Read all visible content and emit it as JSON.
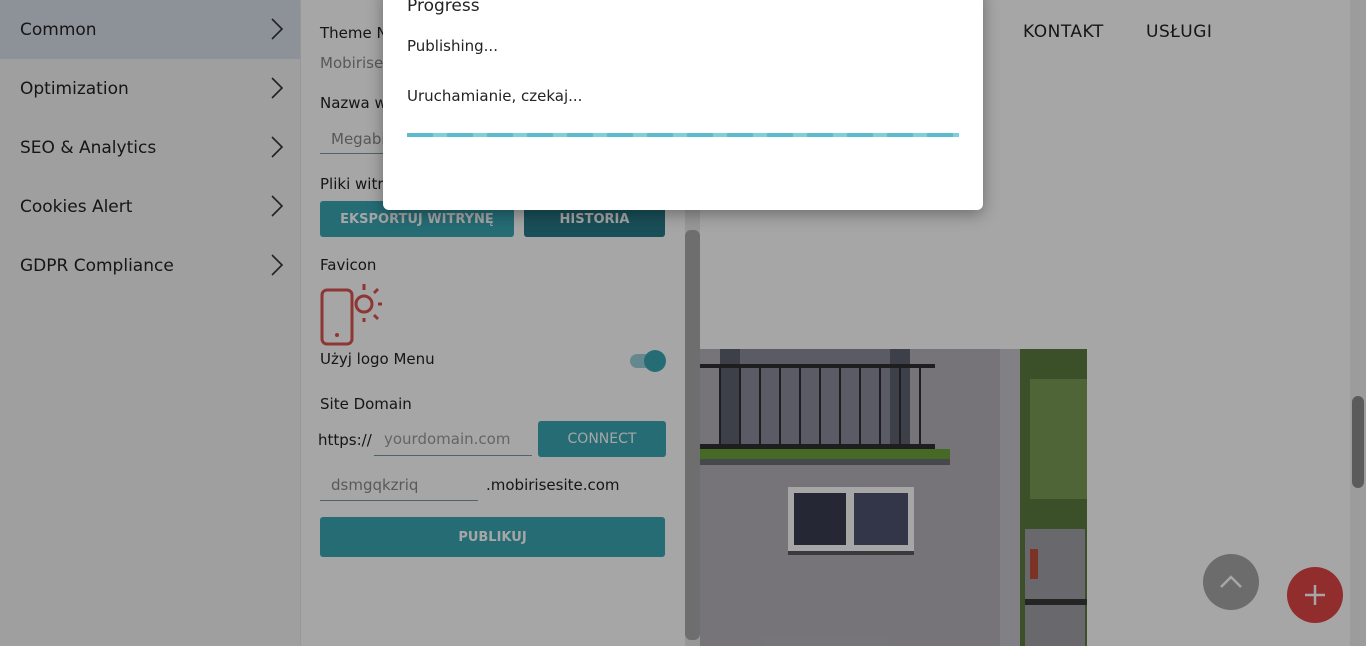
{
  "sidebar": {
    "items": [
      {
        "label": "Common"
      },
      {
        "label": "Optimization"
      },
      {
        "label": "SEO & Analytics"
      },
      {
        "label": "Cookies Alert"
      },
      {
        "label": "GDPR Compliance"
      }
    ]
  },
  "settings": {
    "theme_label": "Theme Na",
    "theme_value": "Mobirise",
    "site_name_label": "Nazwa w",
    "site_name_value": "Megabi",
    "files_label": "Pliki witry",
    "export_button": "EKSPORTUJ WITRYNĘ",
    "history_button": "HISTORIA",
    "favicon_label": "Favicon",
    "favicon_icon": "phone-sun-icon",
    "logo_menu_label": "Użyj logo Menu",
    "logo_menu_toggle_on": true,
    "site_domain_label": "Site Domain",
    "https_prefix": "https://",
    "domain_placeholder": "yourdomain.com",
    "connect_button": "CONNECT",
    "subdomain_value": "dsmgqkzriq",
    "subdomain_suffix": ".mobirisesite.com",
    "publish_button": "PUBLIKUJ"
  },
  "preview": {
    "nav": [
      {
        "label": "KONTAKT"
      },
      {
        "label": "USŁUGI"
      }
    ]
  },
  "modal": {
    "title": "Progress",
    "status": "Publishing...",
    "message": "Uruchamianie, czekaj...",
    "progress_indeterminate": true
  },
  "fabs": {
    "scroll_up_icon": "chevron-up-icon",
    "add_icon": "plus-icon"
  },
  "colors": {
    "accent": "#3aa6b4",
    "accent_dark": "#277a88",
    "fab_red": "#e04545",
    "sidebar_active": "#d9e1ea"
  }
}
